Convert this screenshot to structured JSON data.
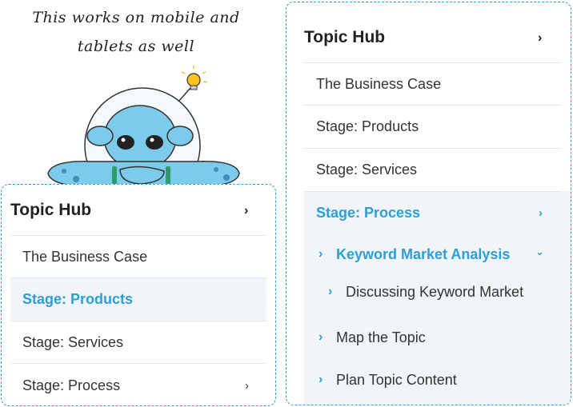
{
  "caption": {
    "line1": "This works on mobile and",
    "line2": "tablets as well"
  },
  "left_menu": {
    "title": "Topic Hub",
    "title_chevron": "›",
    "items": [
      {
        "label": "The Business Case"
      },
      {
        "label": "Stage: Products"
      },
      {
        "label": "Stage: Services"
      },
      {
        "label": "Stage: Process",
        "chevron": "›"
      }
    ]
  },
  "right_menu": {
    "title": "Topic Hub",
    "title_chevron": "›",
    "items": [
      {
        "label": "The Business Case"
      },
      {
        "label": "Stage: Products"
      },
      {
        "label": "Stage: Services"
      },
      {
        "label": "Stage: Process",
        "chevron": "›"
      }
    ],
    "subitems": [
      {
        "label": "Keyword Market Analysis",
        "arrow": "›",
        "expand": "⌄"
      },
      {
        "label": "Discussing Keyword Market",
        "arrow": "›"
      },
      {
        "label": "Map the Topic",
        "arrow": "›"
      },
      {
        "label": "Plan Topic Content",
        "arrow": "›"
      }
    ]
  },
  "colors": {
    "accent": "#2a9fd8",
    "panel_border": "#2b9fd1",
    "shade": "#f1f5f8"
  },
  "icons": [
    "lightbulb-icon",
    "chevron-right-icon",
    "chevron-down-icon",
    "alien-mascot"
  ]
}
